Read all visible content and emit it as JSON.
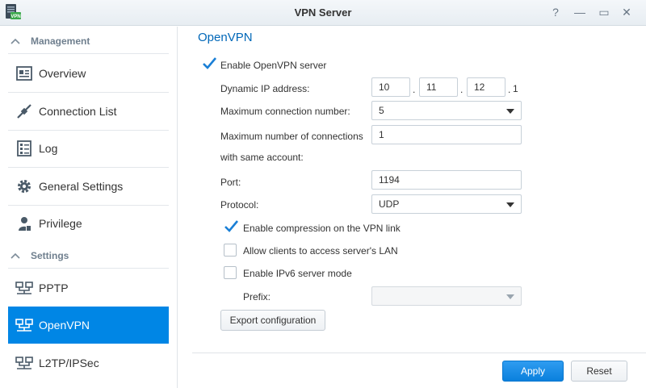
{
  "window": {
    "title": "VPN Server",
    "app_icon_text": "VPN",
    "help_glyph": "?",
    "minimize_glyph": "—",
    "maximize_glyph": "▭",
    "close_glyph": "✕"
  },
  "sidebar": {
    "sections": [
      {
        "label": "Management"
      },
      {
        "label": "Settings"
      }
    ],
    "items": [
      {
        "label": "Overview",
        "icon": "overview-icon"
      },
      {
        "label": "Connection List",
        "icon": "connection-list-icon"
      },
      {
        "label": "Log",
        "icon": "log-icon"
      },
      {
        "label": "General Settings",
        "icon": "gear-icon"
      },
      {
        "label": "Privilege",
        "icon": "user-icon"
      },
      {
        "label": "PPTP",
        "icon": "network-icon"
      },
      {
        "label": "OpenVPN",
        "icon": "network-icon",
        "active": true
      },
      {
        "label": "L2TP/IPSec",
        "icon": "network-icon"
      }
    ]
  },
  "main": {
    "heading": "OpenVPN",
    "enable_server": {
      "label": "Enable OpenVPN server",
      "checked": true
    },
    "dynamic_ip": {
      "label": "Dynamic IP address:",
      "octets": [
        "10",
        "11",
        "12"
      ],
      "last_octet": "1",
      "separator": "."
    },
    "max_connections": {
      "label": "Maximum connection number:",
      "value": "5"
    },
    "max_same_account": {
      "label_line1": "Maximum number of connections",
      "label_line2": "with same account:",
      "value": "1"
    },
    "port": {
      "label": "Port:",
      "value": "1194"
    },
    "protocol": {
      "label": "Protocol:",
      "value": "UDP"
    },
    "enable_compression": {
      "label": "Enable compression on the VPN link",
      "checked": true
    },
    "allow_lan": {
      "label": "Allow clients to access server's LAN",
      "checked": false
    },
    "enable_ipv6": {
      "label": "Enable IPv6 server mode",
      "checked": false
    },
    "prefix": {
      "label": "Prefix:",
      "value": ""
    },
    "export_button": "Export configuration"
  },
  "footer": {
    "apply": "Apply",
    "reset": "Reset"
  },
  "colors": {
    "accent": "#0086e5",
    "heading": "#0067b8",
    "check": "#1a7fd6"
  }
}
